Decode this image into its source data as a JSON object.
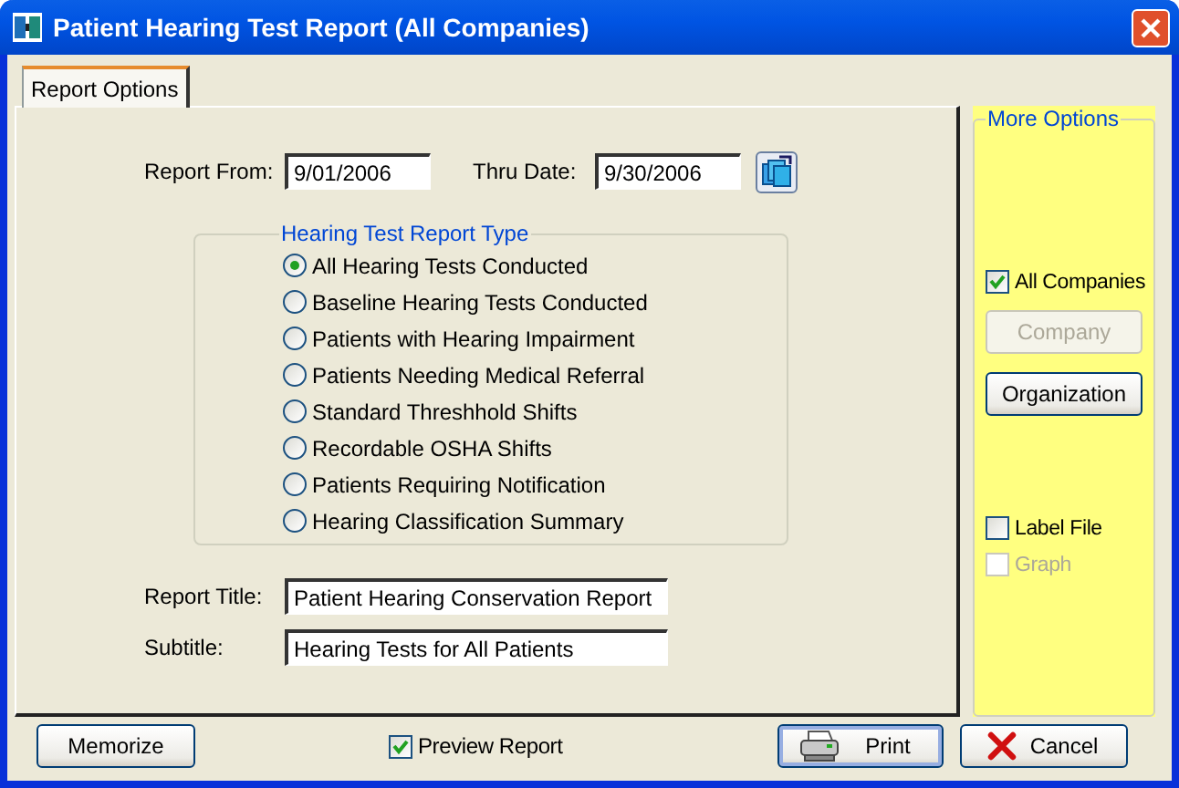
{
  "window": {
    "title": "Patient Hearing Test Report (All Companies)"
  },
  "tabs": [
    {
      "label": "Report Options",
      "selected": true
    }
  ],
  "date_range": {
    "from_label": "Report From:",
    "from_value": "9/01/2006",
    "thru_label": "Thru Date:",
    "thru_value": "9/30/2006"
  },
  "report_type": {
    "legend": "Hearing Test Report Type",
    "options": [
      {
        "label": "All Hearing Tests Conducted",
        "selected": true
      },
      {
        "label": "Baseline Hearing Tests Conducted",
        "selected": false
      },
      {
        "label": "Patients with Hearing Impairment",
        "selected": false
      },
      {
        "label": "Patients Needing Medical Referral",
        "selected": false
      },
      {
        "label": "Standard Threshhold Shifts",
        "selected": false
      },
      {
        "label": "Recordable OSHA Shifts",
        "selected": false
      },
      {
        "label": "Patients Requiring Notification",
        "selected": false
      },
      {
        "label": "Hearing Classification Summary",
        "selected": false
      }
    ]
  },
  "report_title": {
    "label": "Report Title:",
    "value": "Patient Hearing Conservation Report"
  },
  "subtitle": {
    "label": "Subtitle:",
    "value": "Hearing Tests for All Patients"
  },
  "more_options": {
    "legend": "More Options",
    "selection_items": [
      {
        "kind": "checkbox",
        "label": "All Companies",
        "checked": true,
        "disabled": false
      },
      {
        "kind": "button",
        "label": "Company",
        "disabled": true
      },
      {
        "kind": "button",
        "label": "Organization",
        "disabled": false
      }
    ],
    "output_items": [
      {
        "kind": "checkbox",
        "label": "Label File",
        "checked": false,
        "disabled": false
      },
      {
        "kind": "checkbox",
        "label": "Graph",
        "checked": false,
        "disabled": true
      }
    ]
  },
  "footer": {
    "memorize": "Memorize",
    "preview": {
      "label": "Preview Report",
      "checked": true
    },
    "print": "Print",
    "cancel": "Cancel"
  }
}
